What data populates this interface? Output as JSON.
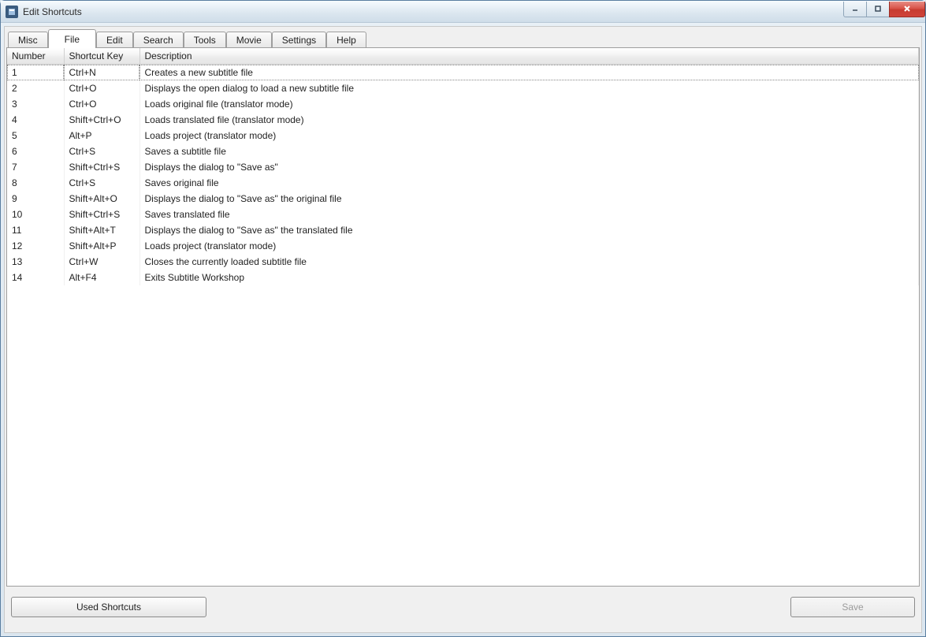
{
  "window": {
    "title": "Edit Shortcuts"
  },
  "tabs": [
    {
      "label": "Misc",
      "active": false
    },
    {
      "label": "File",
      "active": true
    },
    {
      "label": "Edit",
      "active": false
    },
    {
      "label": "Search",
      "active": false
    },
    {
      "label": "Tools",
      "active": false
    },
    {
      "label": "Movie",
      "active": false
    },
    {
      "label": "Settings",
      "active": false
    },
    {
      "label": "Help",
      "active": false
    }
  ],
  "table": {
    "headers": {
      "number": "Number",
      "key": "Shortcut Key",
      "desc": "Description"
    },
    "rows": [
      {
        "number": "1",
        "key": "Ctrl+N",
        "desc": "Creates a new subtitle file"
      },
      {
        "number": "2",
        "key": "Ctrl+O",
        "desc": "Displays the open dialog to load a new subtitle file"
      },
      {
        "number": "3",
        "key": "Ctrl+O",
        "desc": "Loads original file (translator mode)"
      },
      {
        "number": "4",
        "key": "Shift+Ctrl+O",
        "desc": "Loads translated file (translator mode)"
      },
      {
        "number": "5",
        "key": "Alt+P",
        "desc": "Loads project (translator mode)"
      },
      {
        "number": "6",
        "key": "Ctrl+S",
        "desc": "Saves a subtitle file"
      },
      {
        "number": "7",
        "key": "Shift+Ctrl+S",
        "desc": "Displays the dialog to \"Save as\""
      },
      {
        "number": "8",
        "key": "Ctrl+S",
        "desc": "Saves original file"
      },
      {
        "number": "9",
        "key": "Shift+Alt+O",
        "desc": "Displays the dialog to \"Save as\" the original file"
      },
      {
        "number": "10",
        "key": "Shift+Ctrl+S",
        "desc": "Saves translated file"
      },
      {
        "number": "11",
        "key": "Shift+Alt+T",
        "desc": "Displays the dialog to \"Save as\" the translated file"
      },
      {
        "number": "12",
        "key": "Shift+Alt+P",
        "desc": "Loads project (translator mode)"
      },
      {
        "number": "13",
        "key": "Ctrl+W",
        "desc": "Closes the currently loaded subtitle file"
      },
      {
        "number": "14",
        "key": "Alt+F4",
        "desc": "Exits Subtitle Workshop"
      }
    ]
  },
  "buttons": {
    "used_shortcuts": "Used Shortcuts",
    "save": "Save"
  }
}
